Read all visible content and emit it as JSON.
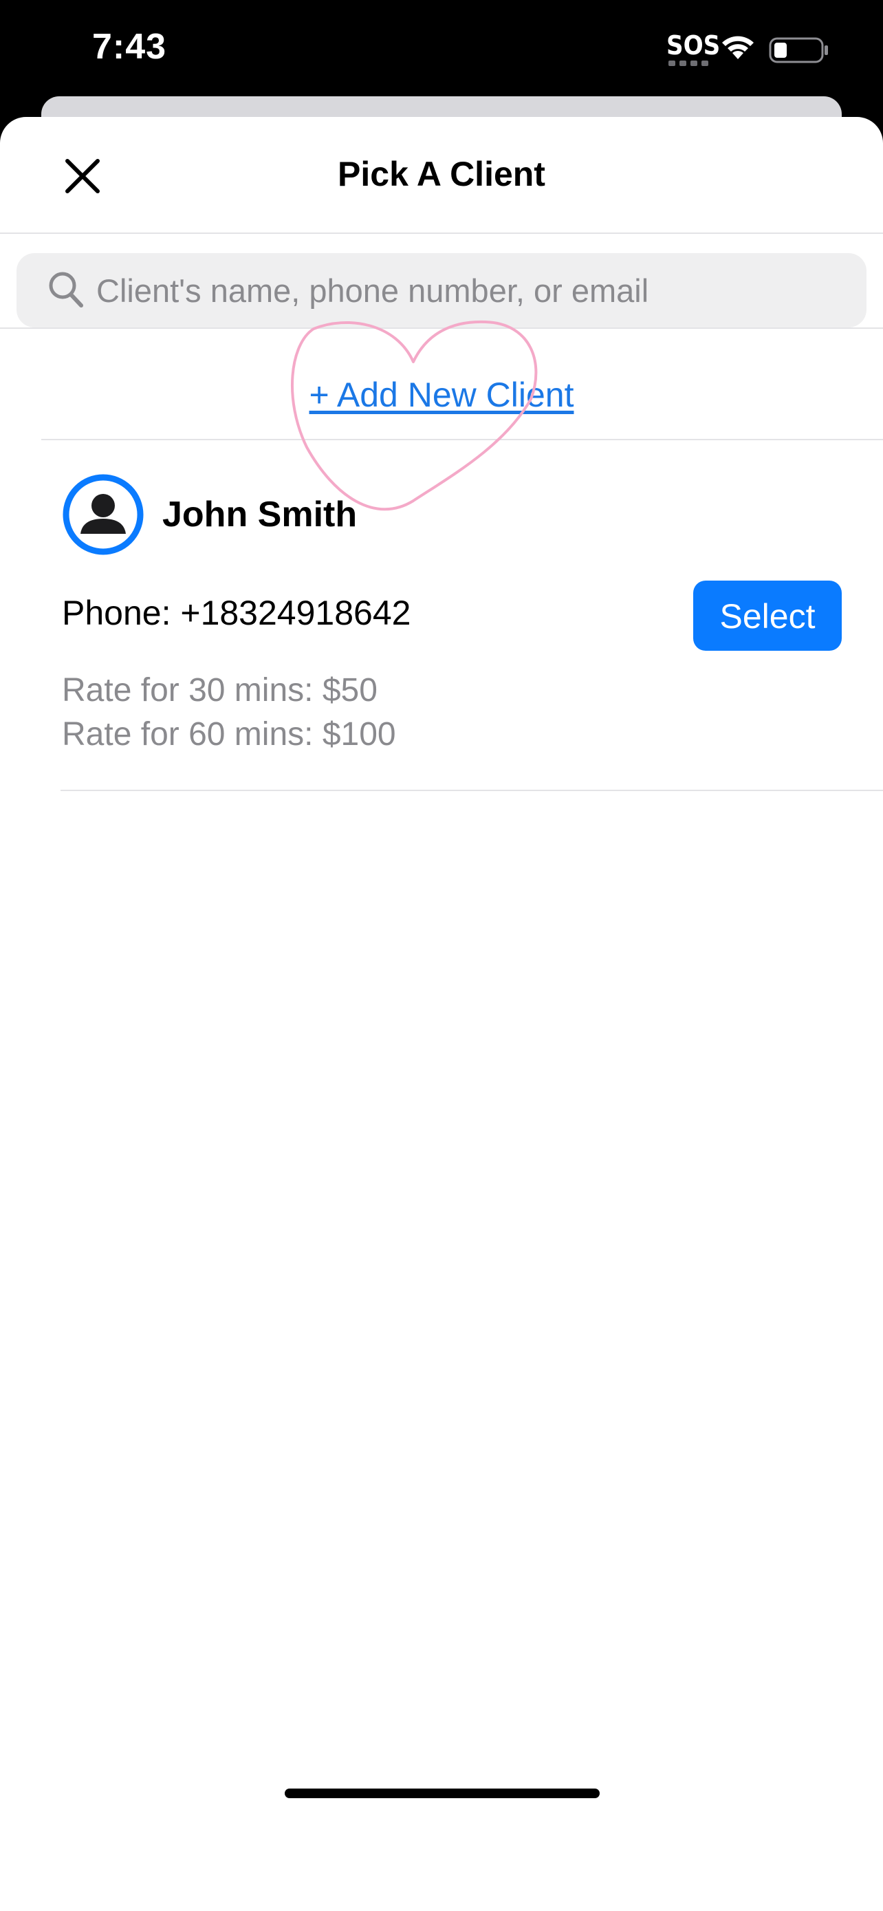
{
  "status_bar": {
    "time": "7:43",
    "sos": "SOS",
    "wifi_icon": "wifi-icon",
    "battery_icon": "battery-low-icon"
  },
  "header": {
    "title": "Pick A Client",
    "close_icon": "close-icon"
  },
  "search": {
    "placeholder": "Client's name, phone number, or email",
    "value": "",
    "icon": "search-icon"
  },
  "add_client": {
    "label": "+ Add New Client"
  },
  "annotation": {
    "icon": "heart-outline-icon",
    "color": "#f4a9c8"
  },
  "clients": [
    {
      "name": "John Smith",
      "phone": "Phone: +18324918642",
      "rates": [
        "Rate for 30 mins: $50",
        "Rate for 60 mins: $100"
      ],
      "select_label": "Select",
      "avatar_icon": "person-circle-icon"
    }
  ],
  "colors": {
    "accent": "#0a7bff",
    "link": "#1b78e6",
    "secondary_text": "#8a8a8e",
    "search_bg": "#efeff0"
  }
}
